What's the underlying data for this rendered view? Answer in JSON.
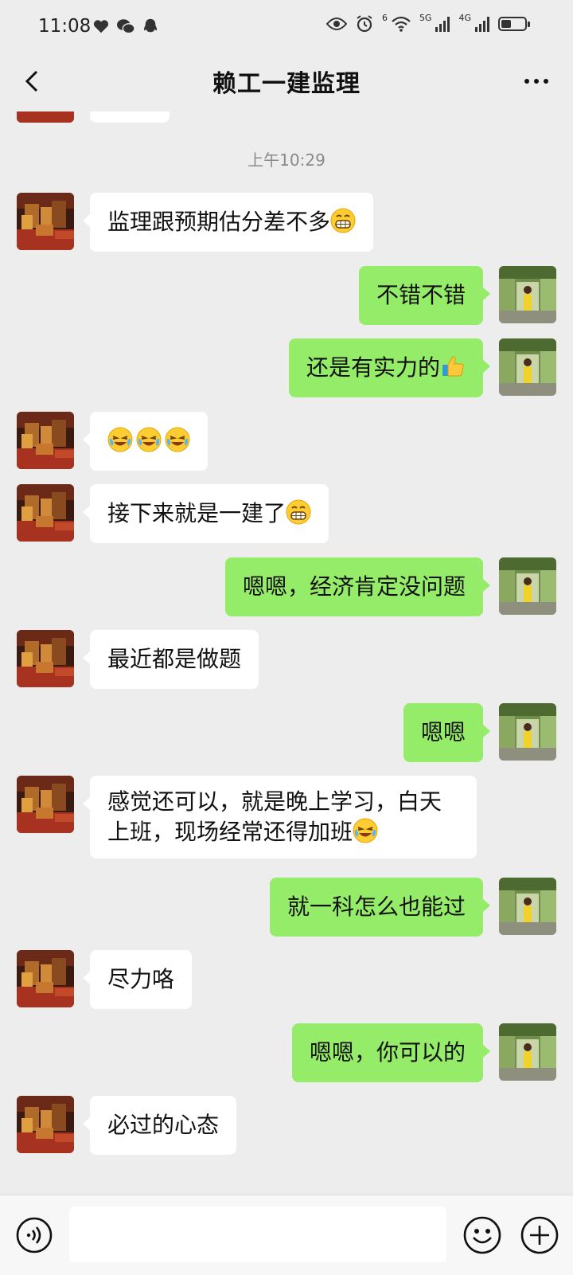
{
  "status_bar": {
    "time": "11:08",
    "wifi_label": "6",
    "net1_label": "5G",
    "net2_label": "4G"
  },
  "header": {
    "title": "赖工一建监理"
  },
  "chat": {
    "timestamp": "上午10:29",
    "messages": [
      {
        "side": "in",
        "text": "监理跟预期估分差不多"
      },
      {
        "side": "out",
        "text": "不错不错"
      },
      {
        "side": "out",
        "text": "还是有实力的"
      },
      {
        "side": "in",
        "text": ""
      },
      {
        "side": "in",
        "text": "接下来就是一建了"
      },
      {
        "side": "out",
        "text": "嗯嗯，经济肯定没问题"
      },
      {
        "side": "in",
        "text": "最近都是做题"
      },
      {
        "side": "out",
        "text": "嗯嗯"
      },
      {
        "side": "in",
        "line1": "感觉还可以，就是晚上学习，白天",
        "line2": "上班，现场经常还得加班"
      },
      {
        "side": "out",
        "text": "就一科怎么也能过"
      },
      {
        "side": "in",
        "text": "尽力咯"
      },
      {
        "side": "out",
        "text": "嗯嗯，你可以的"
      },
      {
        "side": "in",
        "text": "必过的心态"
      }
    ]
  },
  "input_bar": {
    "placeholder": ""
  }
}
